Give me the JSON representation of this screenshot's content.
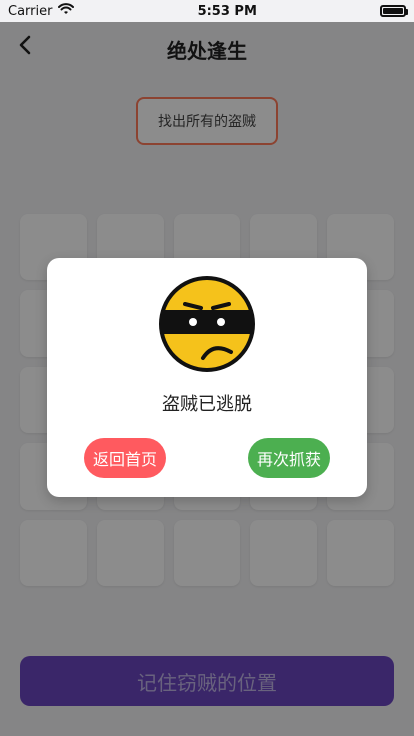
{
  "status": {
    "carrier": "Carrier",
    "time": "5:53 PM"
  },
  "nav": {
    "title": "绝处逢生"
  },
  "hint": {
    "text": "找出所有的盗贼"
  },
  "bottom": {
    "button_label": "记住窃贼的位置"
  },
  "modal": {
    "message": "盗贼已逃脱",
    "home_label": "返回首页",
    "again_label": "再次抓获"
  },
  "colors": {
    "accent_purple": "#6a45c0",
    "hint_border": "#ff7a59",
    "home_button": "#ff5a5f",
    "again_button": "#4caf50"
  },
  "icons": {
    "back": "chevron-left-icon",
    "wifi": "wifi-icon",
    "battery": "battery-icon",
    "thief_face": "masked-thief-emoji-icon"
  }
}
